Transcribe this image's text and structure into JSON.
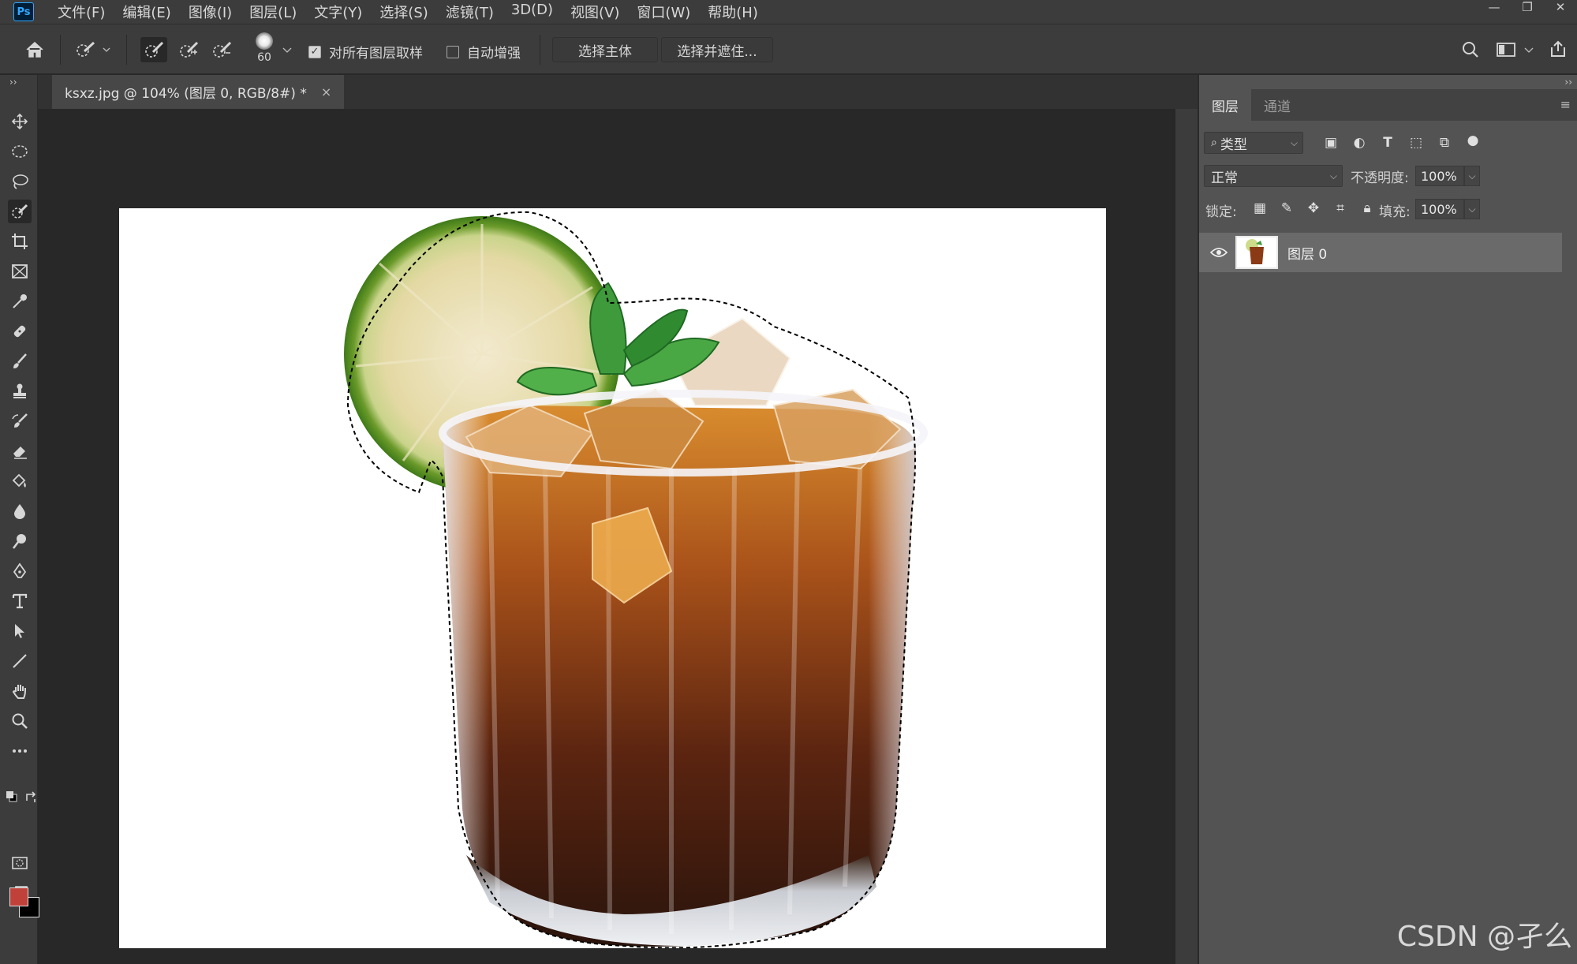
{
  "app": {
    "logo": "Ps"
  },
  "menu": [
    "文件(F)",
    "编辑(E)",
    "图像(I)",
    "图层(L)",
    "文字(Y)",
    "选择(S)",
    "滤镜(T)",
    "3D(D)",
    "视图(V)",
    "窗口(W)",
    "帮助(H)"
  ],
  "window_controls": {
    "minimize": "—",
    "restore": "❐",
    "close": "✕"
  },
  "options_bar": {
    "brush_size": "60",
    "sample_all_layers_label": "对所有图层取样",
    "sample_all_layers_checked": true,
    "auto_enhance_label": "自动增强",
    "auto_enhance_checked": false,
    "select_subject_label": "选择主体",
    "select_and_mask_label": "选择并遮住..."
  },
  "document_tab": {
    "title": "ksxz.jpg @ 104% (图层 0, RGB/8#) *",
    "close": "×"
  },
  "colors": {
    "foreground": "#c0403a",
    "background": "#000000"
  },
  "layers_panel": {
    "tabs": [
      "图层",
      "通道"
    ],
    "filter_label": "类型",
    "blend_mode": "正常",
    "opacity_label": "不透明度:",
    "opacity_value": "100%",
    "lock_label": "锁定:",
    "fill_label": "填充:",
    "fill_value": "100%",
    "layers": [
      {
        "name": "图层 0",
        "visible": true
      }
    ]
  },
  "watermark": "CSDN @孑么"
}
